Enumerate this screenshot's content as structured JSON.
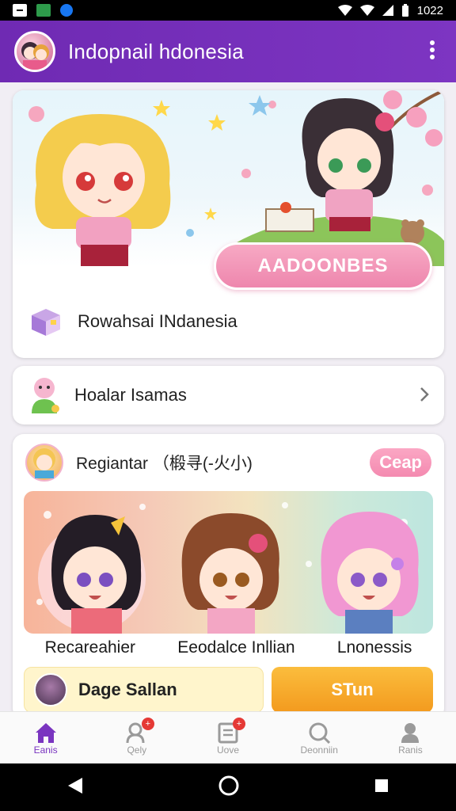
{
  "status_bar": {
    "time": "1022"
  },
  "app_bar": {
    "title": "Indopnail hdonesia"
  },
  "card1": {
    "hero_button_label": "AADOONBES",
    "row_label": "Rowahsai INdanesia"
  },
  "card2": {
    "label": "Hoalar Isamas"
  },
  "card3": {
    "title": "Regiantar （椴寻(-火小)",
    "pill": "Ceap",
    "characters": [
      "Recareahier",
      "Eeodalce Inllian",
      "Lnonessis"
    ],
    "page_label": "Dage Sallan",
    "action_label": "STun"
  },
  "bottom_nav": [
    {
      "label": "Eanis",
      "icon": "home-icon",
      "active": true
    },
    {
      "label": "Qely",
      "icon": "user-add-icon",
      "badge": true
    },
    {
      "label": "Uove",
      "icon": "document-icon",
      "badge": true
    },
    {
      "label": "Deonniin",
      "icon": "search-icon"
    },
    {
      "label": "Ranis",
      "icon": "person-icon"
    }
  ],
  "colors": {
    "primary": "#7331b8",
    "accent_pink": "#f28ab0",
    "accent_orange": "#f5a623"
  }
}
